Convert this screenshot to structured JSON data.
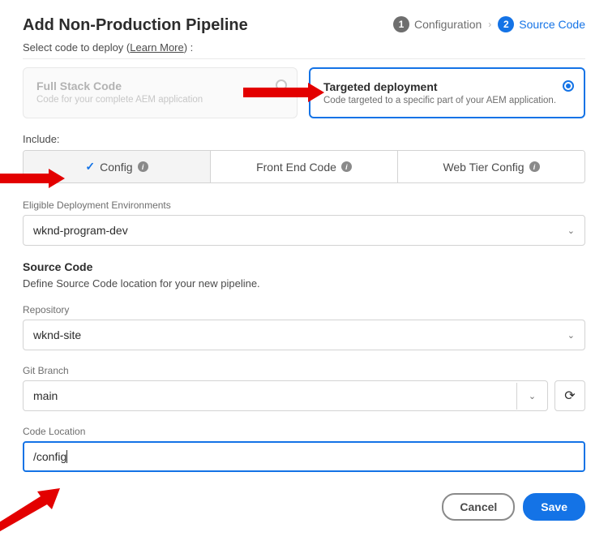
{
  "header": {
    "title": "Add Non-Production Pipeline",
    "steps": [
      {
        "num": "1",
        "label": "Configuration"
      },
      {
        "num": "2",
        "label": "Source Code"
      }
    ],
    "active_step": 2,
    "subheader_prefix": "Select code to deploy  (",
    "subheader_link": "Learn More",
    "subheader_suffix": ") :"
  },
  "cards": {
    "fullstack": {
      "title": "Full Stack Code",
      "sub": "Code for your complete AEM application"
    },
    "targeted": {
      "title": "Targeted deployment",
      "sub": "Code targeted to a specific part of your AEM application."
    }
  },
  "include": {
    "label": "Include:",
    "tabs": [
      {
        "label": "Config",
        "selected": true
      },
      {
        "label": "Front End Code",
        "selected": false
      },
      {
        "label": "Web Tier Config",
        "selected": false
      }
    ]
  },
  "env": {
    "label": "Eligible Deployment Environments",
    "value": "wknd-program-dev"
  },
  "source": {
    "title": "Source Code",
    "desc": "Define Source Code location for your new pipeline."
  },
  "repo": {
    "label": "Repository",
    "value": "wknd-site"
  },
  "branch": {
    "label": "Git Branch",
    "value": "main"
  },
  "location": {
    "label": "Code Location",
    "value": "/config"
  },
  "footer": {
    "cancel": "Cancel",
    "save": "Save"
  }
}
